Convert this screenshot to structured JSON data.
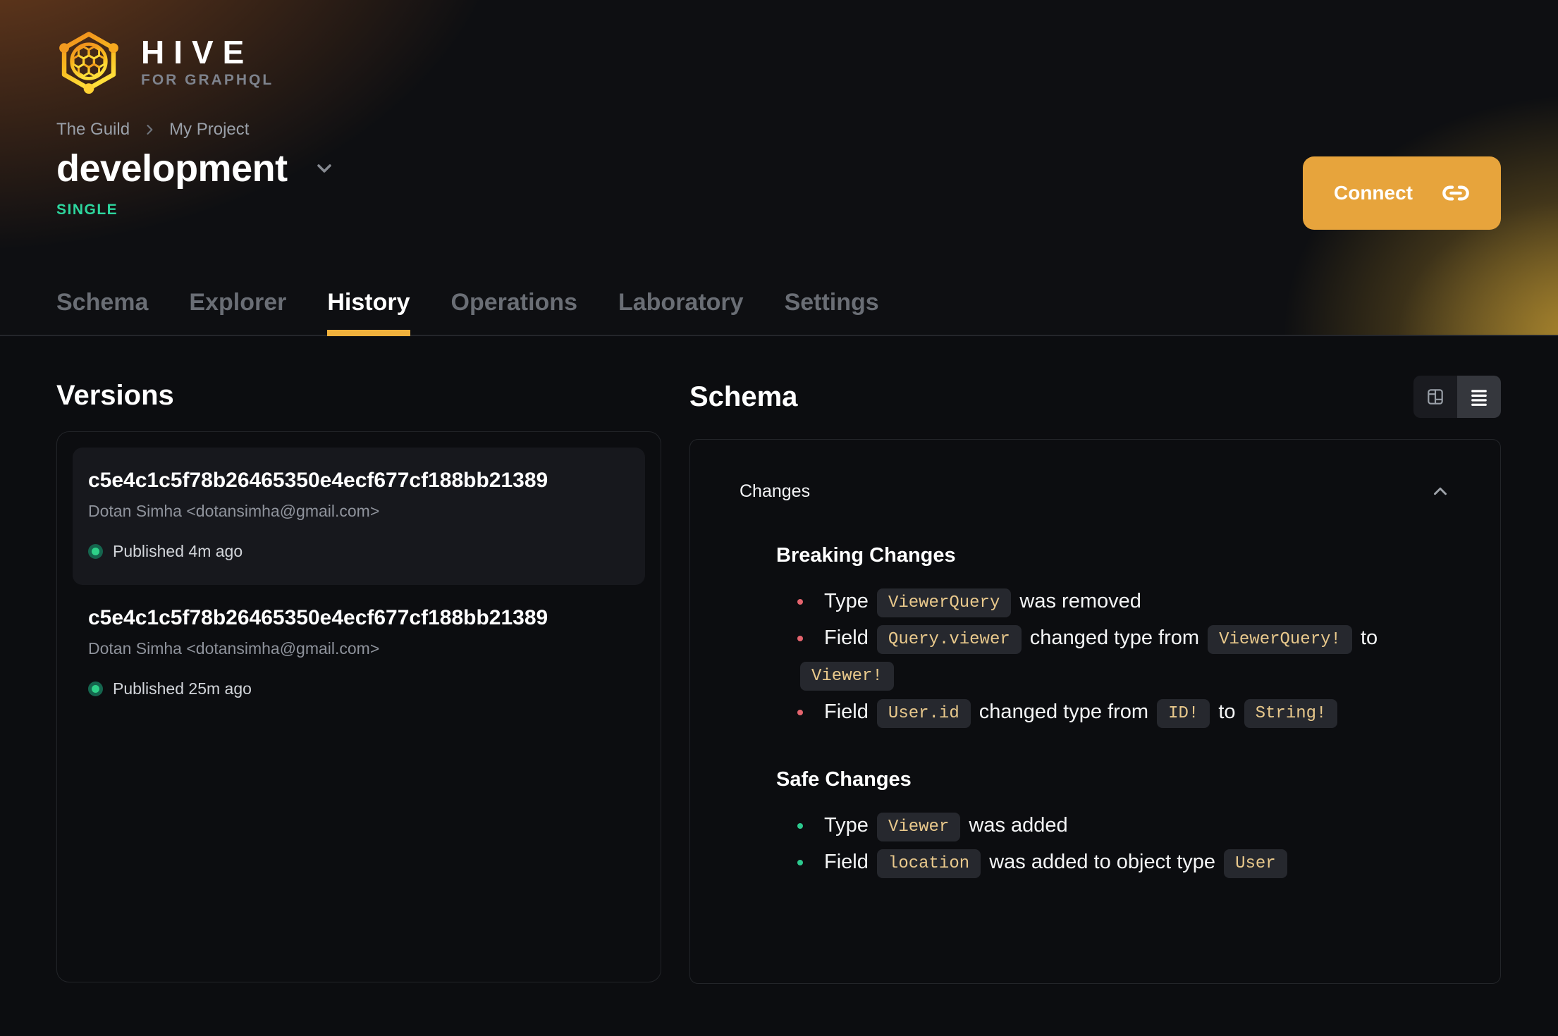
{
  "header": {
    "logo": {
      "title": "HIVE",
      "subtitle": "FOR GRAPHQL"
    },
    "breadcrumb": {
      "org": "The Guild",
      "project": "My Project"
    },
    "target": {
      "name": "development",
      "badge": "SINGLE"
    },
    "connect_label": "Connect"
  },
  "tabs": [
    {
      "label": "Schema",
      "active": false
    },
    {
      "label": "Explorer",
      "active": false
    },
    {
      "label": "History",
      "active": true
    },
    {
      "label": "Operations",
      "active": false
    },
    {
      "label": "Laboratory",
      "active": false
    },
    {
      "label": "Settings",
      "active": false
    }
  ],
  "versions": {
    "title": "Versions",
    "items": [
      {
        "hash": "c5e4c1c5f78b26465350e4ecf677cf188bb21389",
        "author": "Dotan Simha <dotansimha@gmail.com>",
        "status": "Published 4m ago",
        "selected": true
      },
      {
        "hash": "c5e4c1c5f78b26465350e4ecf677cf188bb21389",
        "author": "Dotan Simha <dotansimha@gmail.com>",
        "status": "Published 25m ago",
        "selected": false
      }
    ]
  },
  "schema": {
    "title": "Schema",
    "view_modes": [
      {
        "name": "columns-view",
        "icon": "columns-icon",
        "active": false
      },
      {
        "name": "list-view",
        "icon": "list-icon",
        "active": true
      }
    ],
    "changes": {
      "title": "Changes",
      "collapsed": false,
      "groups": [
        {
          "name": "Breaking Changes",
          "kind": "breaking",
          "items": [
            [
              {
                "text": "Type "
              },
              {
                "code": "ViewerQuery"
              },
              {
                "text": " was removed"
              }
            ],
            [
              {
                "text": "Field "
              },
              {
                "code": "Query.viewer"
              },
              {
                "text": " changed type from "
              },
              {
                "code": "ViewerQuery!"
              },
              {
                "text": " to "
              },
              {
                "code": "Viewer!"
              }
            ],
            [
              {
                "text": "Field "
              },
              {
                "code": "User.id"
              },
              {
                "text": " changed type from "
              },
              {
                "code": "ID!"
              },
              {
                "text": " to "
              },
              {
                "code": "String!"
              }
            ]
          ]
        },
        {
          "name": "Safe Changes",
          "kind": "safe",
          "items": [
            [
              {
                "text": "Type "
              },
              {
                "code": "Viewer"
              },
              {
                "text": " was added"
              }
            ],
            [
              {
                "text": "Field "
              },
              {
                "code": "location"
              },
              {
                "text": " was added to object type "
              },
              {
                "code": "User"
              }
            ]
          ]
        }
      ]
    }
  },
  "colors": {
    "accent_amber": "#e7a43c",
    "tab_underline": "#f1b13c",
    "badge_green": "#2dd69e",
    "breaking_bullet": "#e5646e",
    "safe_bullet": "#2cc98e",
    "chip_text": "#e9c98c",
    "published_dot": "#2ed189"
  }
}
